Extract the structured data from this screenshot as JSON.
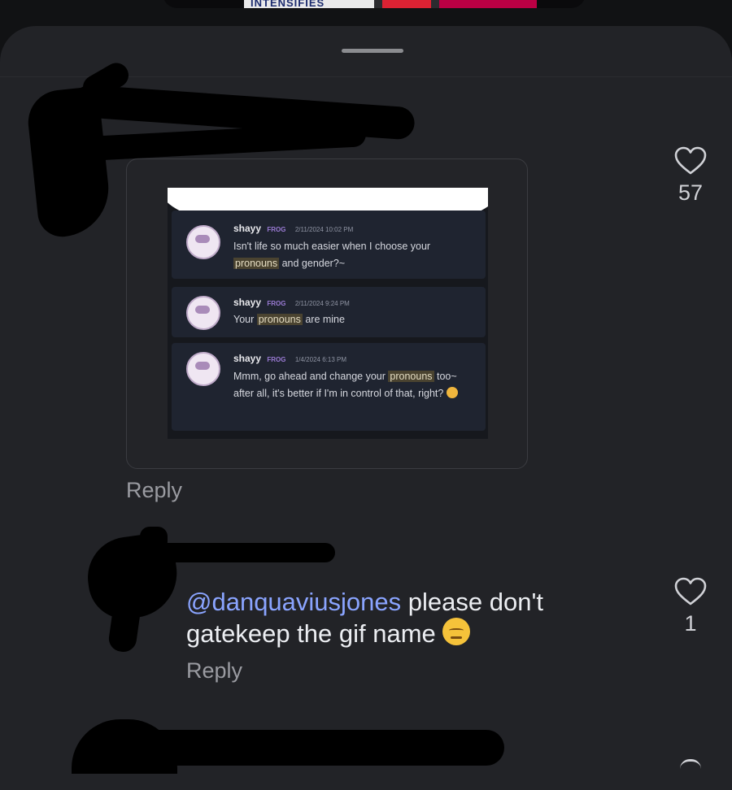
{
  "top_thumbnail": {
    "text": "INTENSIFIES"
  },
  "comments": [
    {
      "image": {
        "messages": [
          {
            "user": "shayy",
            "tag": "FROG",
            "time": "2/11/2024 10:02 PM",
            "parts": [
              "Isn't life so much easier when I choose your ",
              "pronouns",
              " and gender?~"
            ]
          },
          {
            "user": "shayy",
            "tag": "FROG",
            "time": "2/11/2024 9:24 PM",
            "parts": [
              "Your ",
              "pronouns",
              " are mine"
            ]
          },
          {
            "user": "shayy",
            "tag": "FROG",
            "time": "1/4/2024 6:13 PM",
            "parts": [
              "Mmm, go ahead and change your ",
              "pronouns",
              " too~ after all, it's better if I'm in control of that, right?"
            ]
          }
        ]
      },
      "likes": "57",
      "reply_label": "Reply",
      "icons": {
        "like": "heart-outline-icon"
      }
    },
    {
      "mention": "@danquaviusjones",
      "text": " please don't gatekeep the gif name",
      "emoji": "pensive-face",
      "likes": "1",
      "reply_label": "Reply",
      "icons": {
        "like": "heart-outline-icon"
      }
    }
  ],
  "colors": {
    "background": "#111214",
    "sheet": "#222327",
    "mention": "#8aa4ff",
    "muted": "#9a9ba1"
  }
}
